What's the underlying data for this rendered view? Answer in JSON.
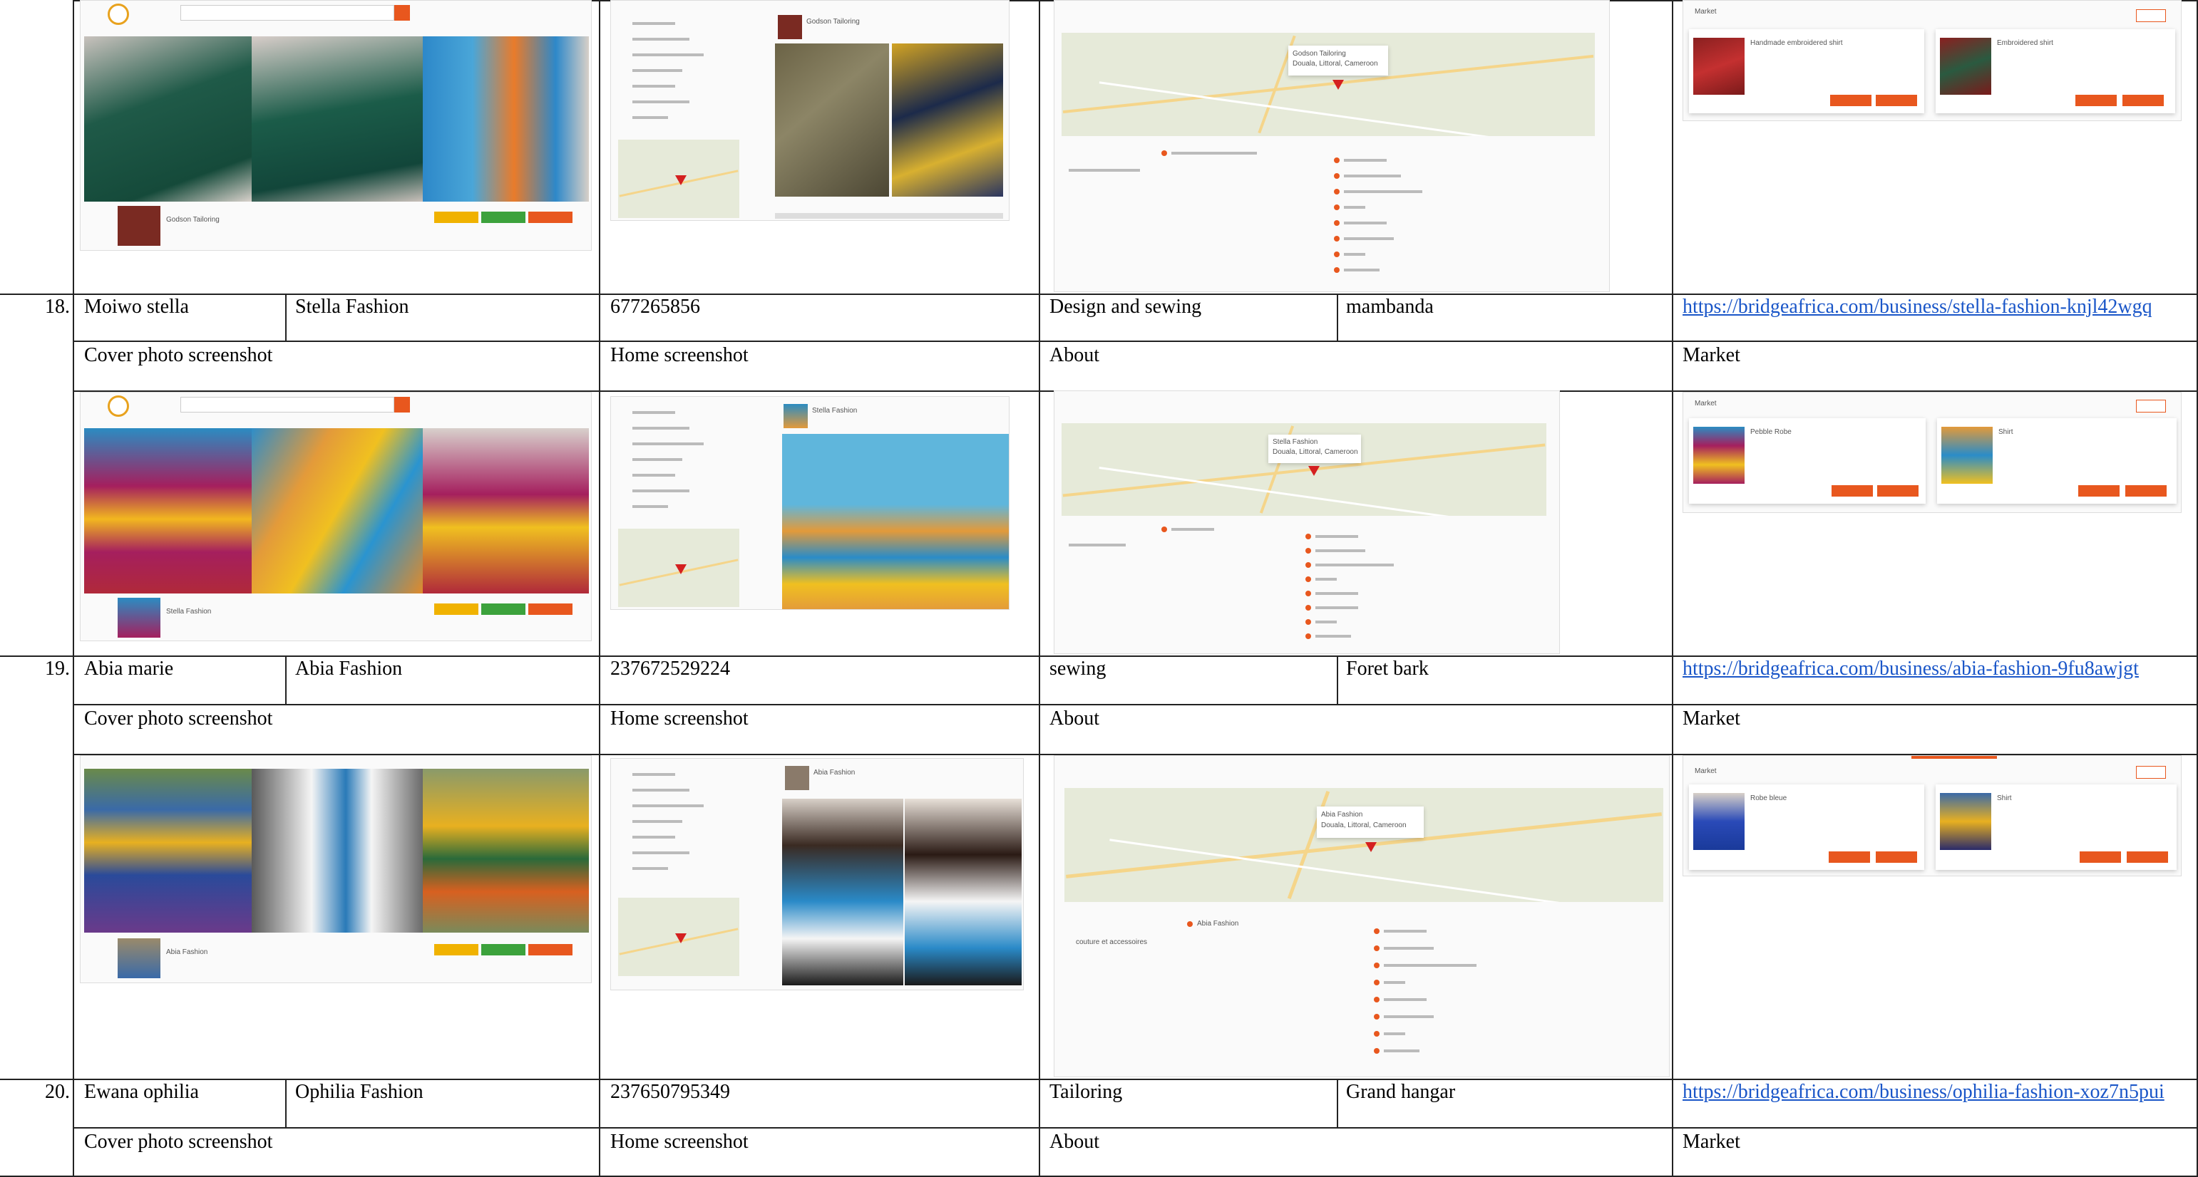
{
  "rows": [
    {
      "num": "18.",
      "owner": "Moiwo stella",
      "business": "Stella Fashion",
      "phone": "677265856",
      "activity": "Design and sewing",
      "location": "mambanda",
      "url": "https://bridgeafrica.com/business/stella-fashion-knjl42wgq"
    },
    {
      "num": "19.",
      "owner": "Abia marie",
      "business": "Abia Fashion",
      "phone": "237672529224",
      "activity": "sewing",
      "location": "Foret bark",
      "url": "https://bridgeafrica.com/business/abia-fashion-9fu8awjgt"
    },
    {
      "num": "20.",
      "owner": "Ewana ophilia",
      "business": "Ophilia Fashion",
      "phone": "237650795349",
      "activity": "Tailoring",
      "location": "Grand hangar",
      "url": "https://bridgeafrica.com/business/ophilia-fashion-xoz7n5pui"
    }
  ],
  "headers": {
    "cover": "Cover photo screenshot",
    "home": "Home screenshot",
    "about": "About",
    "market": "Market"
  },
  "thumbs": {
    "row17": {
      "profile_name": "Godson Tailoring",
      "map_label": "Godson Tailoring",
      "map_sub": "Douala, Littoral, Cameroon",
      "market_title": "Market",
      "product1": "Handmade embroidered shirt",
      "product2": "Embroidered shirt"
    },
    "row18": {
      "profile_name": "Stella Fashion",
      "map_label": "Stella Fashion",
      "map_sub": "Douala, Littoral, Cameroon",
      "market_title": "Market",
      "product1": "Pebble Robe",
      "product2": "Shirt"
    },
    "row19": {
      "profile_name": "Abia Fashion",
      "map_label": "Abia Fashion",
      "map_sub": "Douala, Littoral, Cameroon",
      "about_tag": "Abia Fashion",
      "about_desc": "couture et accessoires",
      "market_title": "Market",
      "product1": "Robe bleue",
      "product2": "Shirt"
    }
  },
  "colors": {
    "accent": "#e8571e",
    "link": "#1a56c8",
    "grid": "#222222"
  }
}
